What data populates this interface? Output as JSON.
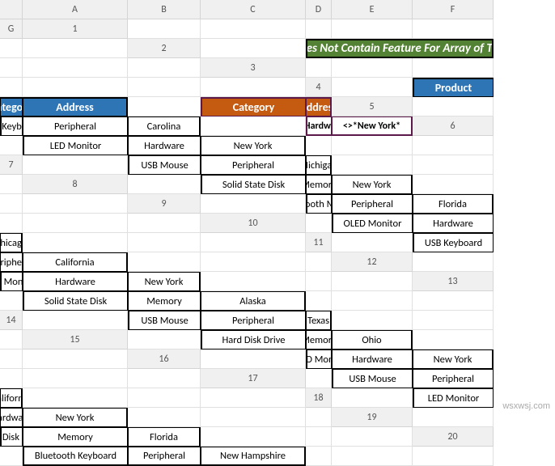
{
  "columns": [
    "A",
    "B",
    "C",
    "D",
    "E",
    "F",
    "G"
  ],
  "rows": [
    "1",
    "2",
    "3",
    "4",
    "5",
    "6",
    "7",
    "8",
    "9",
    "10",
    "11",
    "12",
    "13",
    "14",
    "15",
    "16",
    "17",
    "18",
    "19",
    "20"
  ],
  "title": "Does Not Contain Feature For Array of Text",
  "table": {
    "headers": {
      "product": "Product",
      "category": "Category",
      "address": "Address"
    },
    "rows": [
      {
        "product": "USB Keyboard",
        "category": "Peripheral",
        "address": "Carolina"
      },
      {
        "product": "LED Monitor",
        "category": "Hardware",
        "address": "New York"
      },
      {
        "product": "USB Mouse",
        "category": "Peripheral",
        "address": "Michigan"
      },
      {
        "product": "Solid State Disk",
        "category": "Memory",
        "address": "New York"
      },
      {
        "product": "Bluetooth Mouse",
        "category": "Peripheral",
        "address": "Florida"
      },
      {
        "product": "OLED Monitor",
        "category": "Hardware",
        "address": "Chicago"
      },
      {
        "product": "USB Keyboard",
        "category": "Peripheral",
        "address": "California"
      },
      {
        "product": "LED Monitor",
        "category": "Hardware",
        "address": "New York"
      },
      {
        "product": "Solid State Disk",
        "category": "Memory",
        "address": "Alaska"
      },
      {
        "product": "USB Mouse",
        "category": "Peripheral",
        "address": "Texas"
      },
      {
        "product": "Hard Disk Drive",
        "category": "Memory",
        "address": "Ohio"
      },
      {
        "product": "OLED Monitor",
        "category": "Hardware",
        "address": "New York"
      },
      {
        "product": "USB Mouse",
        "category": "Peripheral",
        "address": "California"
      },
      {
        "product": "LED Monitor",
        "category": "Hardware",
        "address": "New York"
      },
      {
        "product": "Hard Disk Drive",
        "category": "Memory",
        "address": "Florida"
      },
      {
        "product": "Bluetooth Keyboard",
        "category": "Peripheral",
        "address": "New Hampshire"
      }
    ]
  },
  "criteria": {
    "headers": {
      "category": "Category",
      "address": "Address"
    },
    "values": {
      "category": "<>*Hardware*",
      "address": "<>*New York*"
    }
  },
  "watermark": "wsxwsj.com"
}
